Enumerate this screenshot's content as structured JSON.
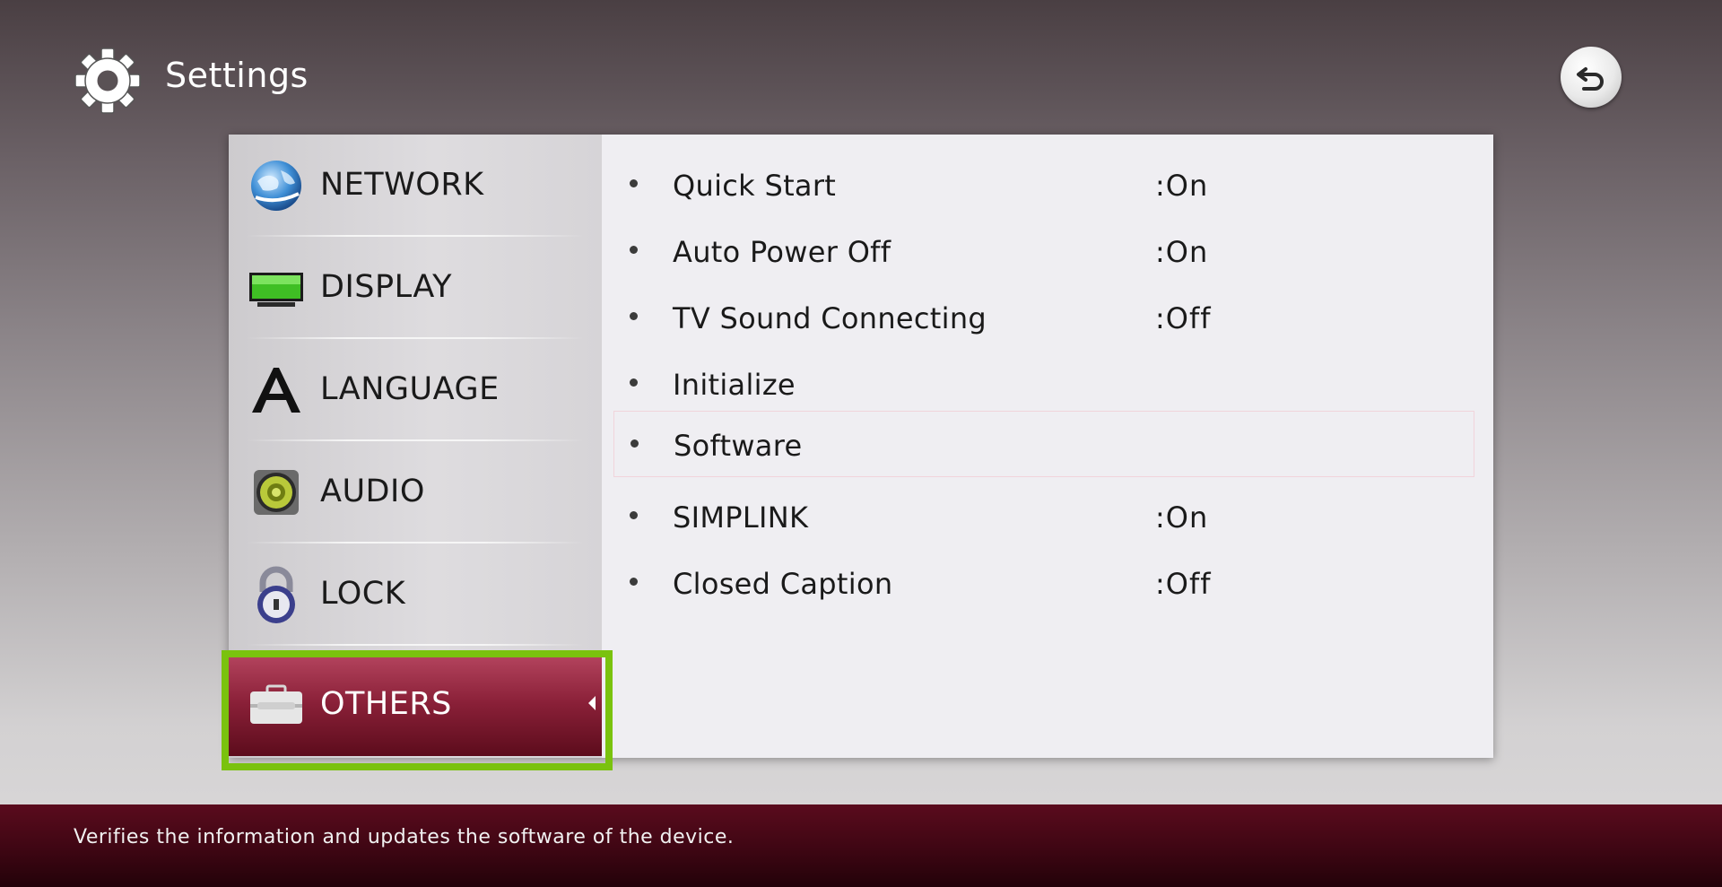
{
  "header": {
    "title": "Settings",
    "icon": "gear-icon",
    "back_icon": "back-arrow-icon"
  },
  "sidebar": {
    "items": [
      {
        "label": "NETWORK",
        "icon": "globe-icon"
      },
      {
        "label": "DISPLAY",
        "icon": "monitor-icon"
      },
      {
        "label": "LANGUAGE",
        "icon": "letter-a-icon"
      },
      {
        "label": "AUDIO",
        "icon": "speaker-icon"
      },
      {
        "label": "LOCK",
        "icon": "padlock-icon"
      },
      {
        "label": "OTHERS",
        "icon": "toolbox-icon"
      }
    ],
    "selected": "OTHERS"
  },
  "options": [
    {
      "name": "Quick Start",
      "value": ":On"
    },
    {
      "name": "Auto Power Off",
      "value": ":On"
    },
    {
      "name": "TV Sound Connecting",
      "value": ":Off"
    },
    {
      "name": "Initialize",
      "value": ""
    },
    {
      "name": "Software",
      "value": ""
    },
    {
      "name": "SIMPLINK",
      "value": ":On"
    },
    {
      "name": "Closed Caption",
      "value": ":Off"
    }
  ],
  "focused_option": "Software",
  "footer": {
    "help_text": "Verifies the information and updates the software of the device."
  },
  "colors": {
    "focus_outline": "#7ac20e",
    "selected_item": "#8a2038",
    "footer_bar": "#3e0613"
  }
}
